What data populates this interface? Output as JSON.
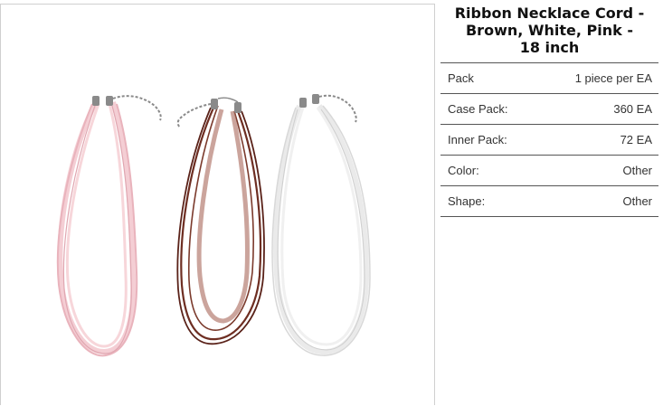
{
  "product": {
    "title_lines": [
      "Ribbon Necklace Cord -",
      "Brown, White, Pink -",
      "18 inch"
    ],
    "image_alt": "three ribbon necklace cords in pink, brown and white"
  },
  "colors": {
    "pink": "#f2c6cc",
    "brown": "#6e2e22",
    "white": "#e8e8e8",
    "clasp": "#8a8a8a"
  },
  "specs": [
    {
      "label": "Pack",
      "value": "1 piece per EA"
    },
    {
      "label": "Case Pack:",
      "value": "360 EA"
    },
    {
      "label": "Inner Pack:",
      "value": "72 EA"
    },
    {
      "label": "Color:",
      "value": "Other"
    },
    {
      "label": "Shape:",
      "value": "Other"
    }
  ]
}
